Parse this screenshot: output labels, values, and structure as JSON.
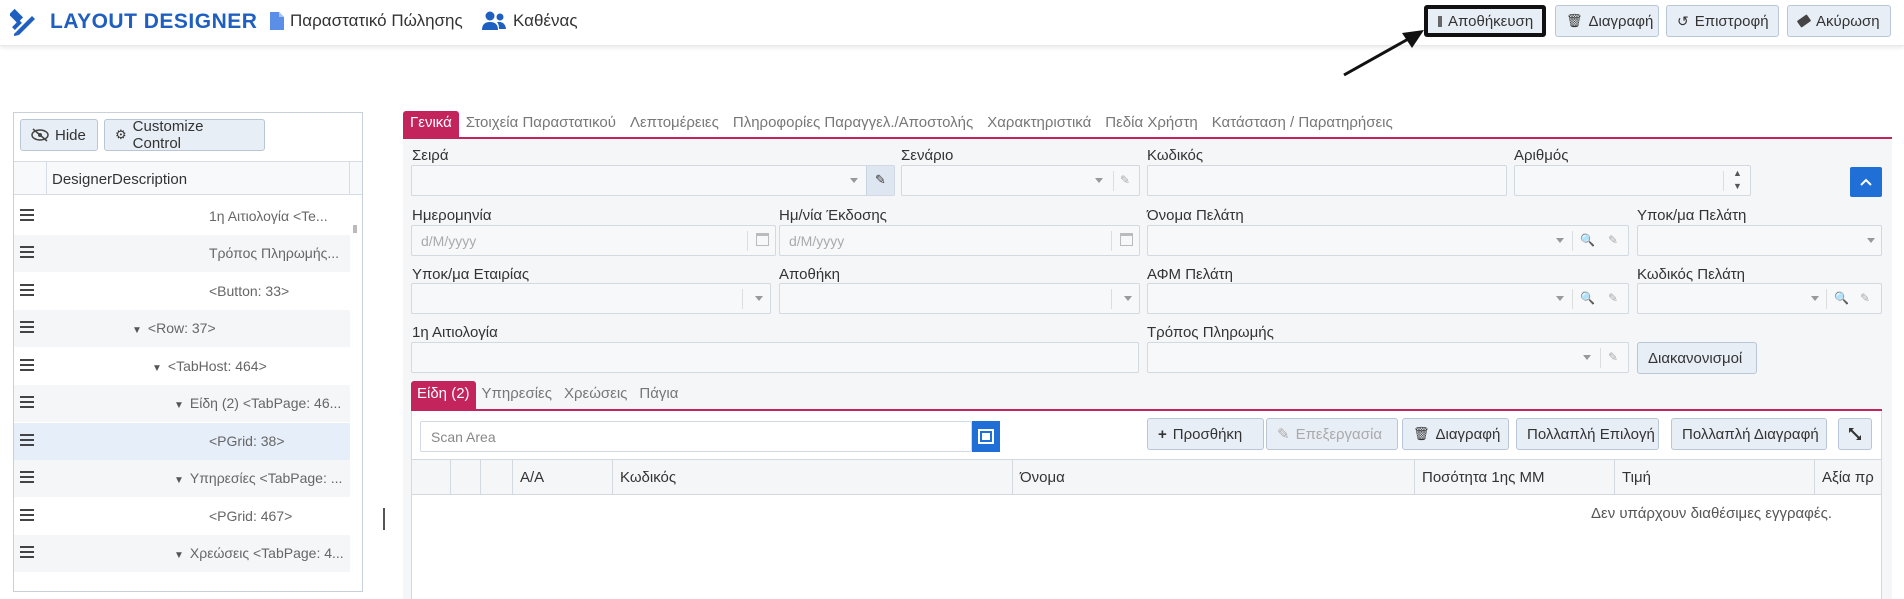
{
  "header": {
    "app_title": "LAYOUT DESIGNER",
    "document_label": "Παραστατικό Πώλησης",
    "audience_label": "Καθένας",
    "buttons": {
      "save": "Αποθήκευση",
      "delete": "Διαγραφή",
      "revert": "Επιστροφή",
      "cancel": "Ακύρωση"
    }
  },
  "left_panel": {
    "hide_label": "Hide",
    "customize_label": "Customize Control",
    "column_header": "DesignerDescription",
    "tree_items": [
      {
        "label": "1η Αιτιολογία <Te..."
      },
      {
        "label": "Τρόπος Πληρωμής..."
      },
      {
        "label": "<Button: 33>"
      },
      {
        "label": "<Row: 37>"
      },
      {
        "label": "<TabHost: 464>"
      },
      {
        "label": "Είδη (2) <TabPage: 46..."
      },
      {
        "label": "<PGrid: 38>"
      },
      {
        "label": "Υπηρεσίες <TabPage: ..."
      },
      {
        "label": "<PGrid: 467>"
      },
      {
        "label": "Χρεώσεις <TabPage: 4..."
      }
    ]
  },
  "main_tabs": [
    {
      "label": "Γενικά"
    },
    {
      "label": "Στοιχεία Παραστατικού"
    },
    {
      "label": "Λεπτομέρειες"
    },
    {
      "label": "Πληροφορίες Παραγγελ./Αποστολής"
    },
    {
      "label": "Χαρακτηριστικά"
    },
    {
      "label": "Πεδία Χρήστη"
    },
    {
      "label": "Κατάσταση / Παρατηρήσεις"
    }
  ],
  "form": {
    "series": "Σειρά",
    "scenario": "Σενάριο",
    "code": "Κωδικός",
    "number": "Αριθμός",
    "date": "Ημερομηνία",
    "issue_date": "Ημ/νία Έκδοσης",
    "date_placeholder": "d/M/yyyy",
    "customer_name": "Όνομα Πελάτη",
    "customer_branch": "Υποκ/μα Πελάτη",
    "company_branch": "Υποκ/μα Εταιρίας",
    "warehouse": "Αποθήκη",
    "customer_vat": "ΑΦΜ Πελάτη",
    "customer_code": "Κωδικός Πελάτη",
    "first_reason": "1η Αιτιολογία",
    "payment_method": "Τρόπος Πληρωμής",
    "settlements_button": "Διακανονισμοί"
  },
  "sub_tabs": [
    {
      "label": "Είδη (2)"
    },
    {
      "label": "Υπηρεσίες"
    },
    {
      "label": "Χρεώσεις"
    },
    {
      "label": "Πάγια"
    }
  ],
  "items_grid": {
    "scan_placeholder": "Scan Area",
    "buttons": {
      "add": "Προσθήκη",
      "edit": "Επεξεργασία",
      "delete": "Διαγραφή",
      "multi_select": "Πολλαπλή Επιλογή",
      "multi_delete": "Πολλαπλή Διαγραφή"
    },
    "columns": [
      "Α/Α",
      "Κωδικός",
      "Όνομα",
      "Ποσότητα 1ης ΜΜ",
      "Τιμή",
      "Αξία πρ"
    ],
    "empty_message": "Δεν υπάρχουν διαθέσιμες εγγραφές."
  },
  "colors": {
    "brand_blue": "#1f5fbf",
    "accent_pink": "#c3245b",
    "action_blue": "#1f6fd6"
  }
}
